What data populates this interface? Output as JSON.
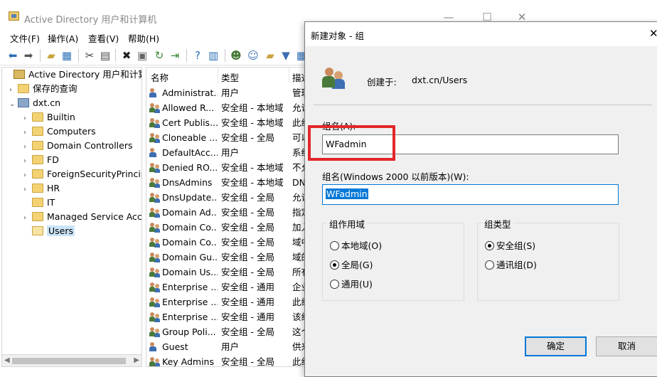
{
  "main": {
    "title": "Active Directory 用户和计算机",
    "menu": [
      "文件(F)",
      "操作(A)",
      "查看(V)",
      "帮助(H)"
    ],
    "tree": [
      {
        "label": "Active Directory 用户和计算机",
        "arrow": "",
        "icon": "root",
        "indent": 0
      },
      {
        "label": "保存的查询",
        "arrow": "›",
        "icon": "folder",
        "indent": 1
      },
      {
        "label": "dxt.cn",
        "arrow": "⌄",
        "icon": "domain",
        "indent": 1
      },
      {
        "label": "Builtin",
        "arrow": "›",
        "icon": "folder",
        "indent": 2
      },
      {
        "label": "Computers",
        "arrow": "›",
        "icon": "folder",
        "indent": 2
      },
      {
        "label": "Domain Controllers",
        "arrow": "›",
        "icon": "folder",
        "indent": 2
      },
      {
        "label": "FD",
        "arrow": "›",
        "icon": "folder",
        "indent": 2
      },
      {
        "label": "ForeignSecurityPrincipals",
        "arrow": "›",
        "icon": "folder",
        "indent": 2
      },
      {
        "label": "HR",
        "arrow": "›",
        "icon": "folder",
        "indent": 2
      },
      {
        "label": "IT",
        "arrow": "",
        "icon": "folder",
        "indent": 2
      },
      {
        "label": "Managed Service Accounts",
        "arrow": "›",
        "icon": "folder",
        "indent": 2
      },
      {
        "label": "Users",
        "arrow": "",
        "icon": "folder-open",
        "indent": 2,
        "selected": true
      }
    ],
    "list_headers": [
      "名称",
      "类型",
      "描述"
    ],
    "list_rows": [
      {
        "name": "Administrat...",
        "type": "用户",
        "desc": "管理",
        "kind": "user"
      },
      {
        "name": "Allowed R...",
        "type": "安全组 - 本地域",
        "desc": "允许",
        "kind": "group"
      },
      {
        "name": "Cert Publis...",
        "type": "安全组 - 本地域",
        "desc": "此组",
        "kind": "group"
      },
      {
        "name": "Cloneable ...",
        "type": "安全组 - 全局",
        "desc": "可以",
        "kind": "group"
      },
      {
        "name": "DefaultAcc...",
        "type": "用户",
        "desc": "系统",
        "kind": "user"
      },
      {
        "name": "Denied RO...",
        "type": "安全组 - 本地域",
        "desc": "不允",
        "kind": "group"
      },
      {
        "name": "DnsAdmins",
        "type": "安全组 - 本地域",
        "desc": "DNS",
        "kind": "group"
      },
      {
        "name": "DnsUpdate...",
        "type": "安全组 - 全局",
        "desc": "允许",
        "kind": "group"
      },
      {
        "name": "Domain Ad...",
        "type": "安全组 - 全局",
        "desc": "指定",
        "kind": "group"
      },
      {
        "name": "Domain Co...",
        "type": "安全组 - 全局",
        "desc": "加入",
        "kind": "group"
      },
      {
        "name": "Domain Co...",
        "type": "安全组 - 全局",
        "desc": "域中",
        "kind": "group"
      },
      {
        "name": "Domain Gu...",
        "type": "安全组 - 全局",
        "desc": "域的",
        "kind": "group"
      },
      {
        "name": "Domain Us...",
        "type": "安全组 - 全局",
        "desc": "所有",
        "kind": "group"
      },
      {
        "name": "Enterprise ...",
        "type": "安全组 - 通用",
        "desc": "企业",
        "kind": "group"
      },
      {
        "name": "Enterprise ...",
        "type": "安全组 - 通用",
        "desc": "此组",
        "kind": "group"
      },
      {
        "name": "Enterprise ...",
        "type": "安全组 - 通用",
        "desc": "该组",
        "kind": "group"
      },
      {
        "name": "Group Poli...",
        "type": "安全组 - 全局",
        "desc": "这个",
        "kind": "group"
      },
      {
        "name": "Guest",
        "type": "用户",
        "desc": "供来",
        "kind": "user"
      },
      {
        "name": "Key Admins",
        "type": "安全组 - 全局",
        "desc": "此组",
        "kind": "group"
      }
    ]
  },
  "dialog": {
    "title": "新建对象 - 组",
    "created_label": "创建于:",
    "created_value": "dxt.cn/Users",
    "name_label": "组名(A):",
    "name_value": "WFadmin",
    "name2_label": "组名(Windows 2000 以前版本)(W):",
    "name2_value": "WFadmin",
    "scope_title": "组作用域",
    "scope_options": [
      "本地域(O)",
      "全局(G)",
      "通用(U)"
    ],
    "scope_selected": 1,
    "type_title": "组类型",
    "type_options": [
      "安全组(S)",
      "通讯组(D)"
    ],
    "type_selected": 0,
    "ok": "确定",
    "cancel": "取消"
  },
  "colors": {
    "highlight_box": "#e2272b",
    "selection": "#0078d7"
  }
}
